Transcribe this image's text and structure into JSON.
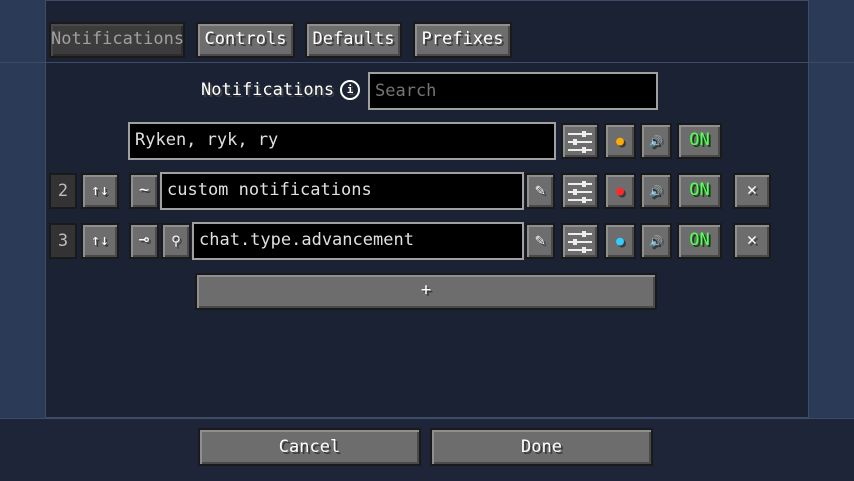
{
  "tabs": [
    {
      "label": "Notifications",
      "active": true
    },
    {
      "label": "Controls",
      "active": false
    },
    {
      "label": "Defaults",
      "active": false
    },
    {
      "label": "Prefixes",
      "active": false
    }
  ],
  "section_label": "Notifications",
  "search": {
    "placeholder": "Search",
    "value": ""
  },
  "rows": [
    {
      "number": "",
      "text": "Ryken, ryk, ry",
      "status": "ON",
      "color_name": "orange",
      "color": "#ffaa00"
    },
    {
      "number": "2",
      "prefix_icon": "tilde",
      "text": "custom notifications",
      "status": "ON",
      "color_name": "red",
      "color": "#ff3333"
    },
    {
      "number": "3",
      "prefix_icon": "key",
      "text": "chat.type.advancement",
      "status": "ON",
      "color_name": "cyan",
      "color": "#33ccff"
    }
  ],
  "icons": {
    "move": "↑↓",
    "tilde": "~",
    "key": "⊸",
    "search": "🔍",
    "edit": "✎",
    "sound": "🔊",
    "remove": "✕",
    "add": "+",
    "settings": "sliders-icon"
  },
  "footer": {
    "cancel": "Cancel",
    "done": "Done"
  },
  "colors": {
    "on_text": "#55ff55",
    "background": "#2b3a57",
    "panel": "#1b2233"
  }
}
